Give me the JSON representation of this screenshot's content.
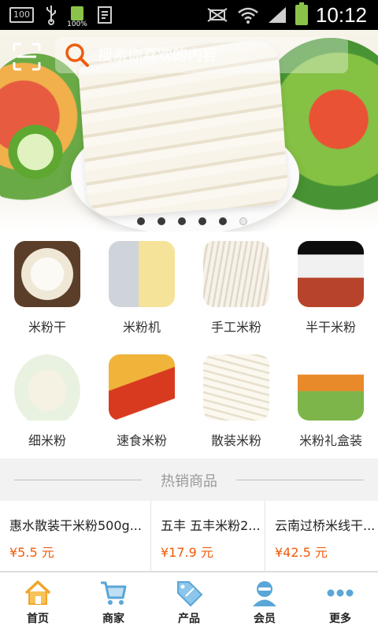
{
  "status_bar": {
    "left_badge": "100",
    "battery_small": "100%",
    "time": "10:12"
  },
  "search": {
    "placeholder": "搜索你喜欢的内容"
  },
  "banner": {
    "dot_count": 6,
    "active_dot": 0
  },
  "categories": [
    {
      "label": "米粉干",
      "icon": "rice-noodle-dry"
    },
    {
      "label": "米粉机",
      "icon": "noodle-machine"
    },
    {
      "label": "手工米粉",
      "icon": "handmade-noodle"
    },
    {
      "label": "半干米粉",
      "icon": "semi-dry-noodle"
    },
    {
      "label": "细米粉",
      "icon": "thin-noodle"
    },
    {
      "label": "速食米粉",
      "icon": "instant-noodle"
    },
    {
      "label": "散装米粉",
      "icon": "bulk-noodle"
    },
    {
      "label": "米粉礼盒装",
      "icon": "gift-box-noodle"
    }
  ],
  "hot_section": {
    "title": "热销商品"
  },
  "products": [
    {
      "name": "惠水散装干米粉500g...",
      "price": "¥5.5 元"
    },
    {
      "name": "五丰 五丰米粉2...",
      "price": "¥17.9 元"
    },
    {
      "name": "云南过桥米线干...",
      "price": "¥42.5 元"
    }
  ],
  "nav": [
    {
      "label": "首页",
      "icon": "home-icon",
      "color": "#f0a42b"
    },
    {
      "label": "商家",
      "icon": "cart-icon",
      "color": "#5aa6d8"
    },
    {
      "label": "产品",
      "icon": "sale-tag-icon",
      "color": "#5aa6d8"
    },
    {
      "label": "会员",
      "icon": "member-icon",
      "color": "#5aa6d8"
    },
    {
      "label": "更多",
      "icon": "more-icon",
      "color": "#5aa6d8"
    }
  ],
  "colors": {
    "price": "#ef5b0c",
    "accent_blue": "#5aa6d8",
    "home_orange": "#f0a42b"
  }
}
